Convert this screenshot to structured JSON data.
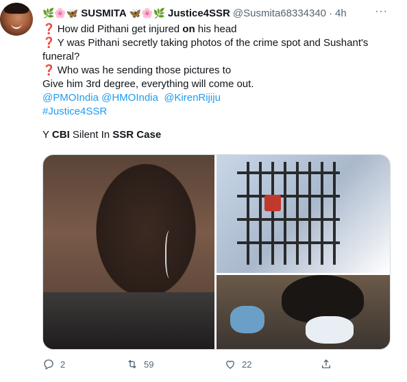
{
  "tweet": {
    "display_name_prefix": "🌿🌸🦋",
    "display_name": "SUSMITA",
    "display_name_suffix": "🦋🌸🌿",
    "display_name_tag": "Justice4SSR",
    "handle": "@Susmita68334340",
    "dot": "·",
    "time": "4h",
    "more": "···",
    "lines": {
      "l1_q": "❓",
      "l1_a": "How did Pithani get injured ",
      "l1_b": "on",
      "l1_c": " his head",
      "l2_q": "❓",
      "l2": "Y was Pithani secretly taking photos of the crime spot and Sushant's",
      "l3": "funeral?",
      "l4_q": "❓",
      "l4": "Who was he sending those pictures to",
      "l5": "Give him 3rd degree, everything will come out.",
      "mentions": [
        "@PMOIndia",
        "@HMOIndia",
        "@KirenRijiju"
      ],
      "hashtag": "#Justice4SSR",
      "l8_a": "Y ",
      "l8_b": "CBI",
      "l8_c": " Silent In ",
      "l8_d": "SSR Case"
    },
    "metrics": {
      "replies": "2",
      "retweets": "59",
      "likes": "22"
    }
  },
  "icons": [
    "reply-icon",
    "retweet-icon",
    "like-icon",
    "share-icon",
    "more-icon"
  ]
}
